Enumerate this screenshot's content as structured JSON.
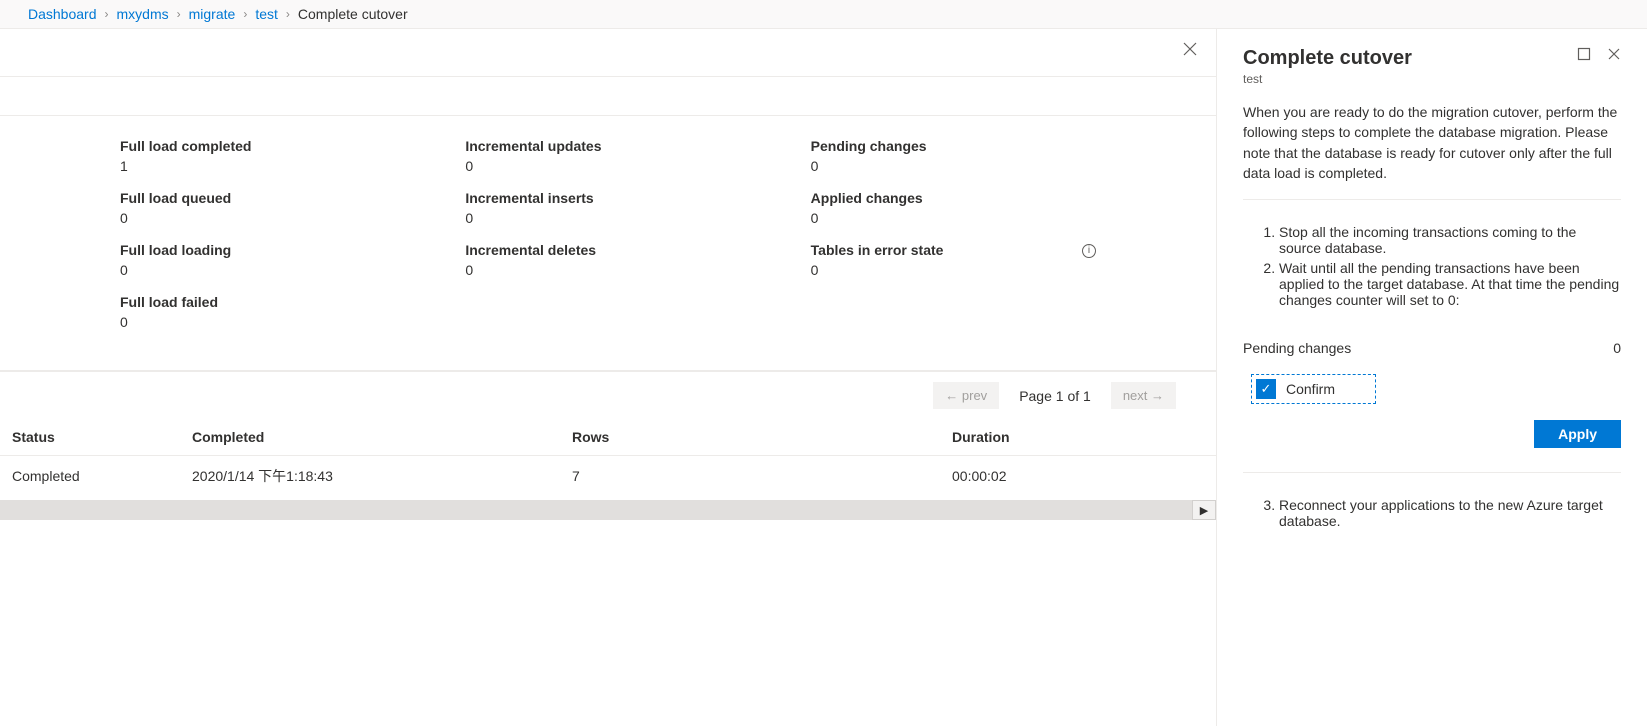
{
  "breadcrumb": {
    "items": [
      {
        "label": "Dashboard",
        "link": true
      },
      {
        "label": "mxydms",
        "link": true
      },
      {
        "label": "migrate",
        "link": true
      },
      {
        "label": "test",
        "link": true
      },
      {
        "label": "Complete cutover",
        "link": false
      }
    ]
  },
  "metrics": {
    "col1": [
      {
        "label": "Full load completed",
        "value": "1"
      },
      {
        "label": "Full load queued",
        "value": "0"
      },
      {
        "label": "Full load loading",
        "value": "0"
      },
      {
        "label": "Full load failed",
        "value": "0"
      }
    ],
    "col2": [
      {
        "label": "Incremental updates",
        "value": "0"
      },
      {
        "label": "Incremental inserts",
        "value": "0"
      },
      {
        "label": "Incremental deletes",
        "value": "0"
      }
    ],
    "col3": [
      {
        "label": "Pending changes",
        "value": "0"
      },
      {
        "label": "Applied changes",
        "value": "0"
      },
      {
        "label": "Tables in error state",
        "value": "0",
        "info": true
      }
    ]
  },
  "paging": {
    "prev": "← prev",
    "text": "Page 1 of 1",
    "next": "next →"
  },
  "table": {
    "headers": {
      "status": "Status",
      "completed": "Completed",
      "rows": "Rows",
      "duration": "Duration"
    },
    "rows": [
      {
        "status": "Completed",
        "completed": "2020/1/14 下午1:18:43",
        "rows": "7",
        "duration": "00:00:02"
      }
    ]
  },
  "panel": {
    "title": "Complete cutover",
    "subtitle": "test",
    "intro": "When you are ready to do the migration cutover, perform the following steps to complete the database migration. Please note that the database is ready for cutover only after the full data load is completed.",
    "steps12": [
      "Stop all the incoming transactions coming to the source database.",
      "Wait until all the pending transactions have been applied to the target database. At that time the pending changes counter will set to 0:"
    ],
    "pending_label": "Pending changes",
    "pending_value": "0",
    "confirm_label": "Confirm",
    "apply_label": "Apply",
    "step3": "Reconnect your applications to the new Azure target database."
  }
}
